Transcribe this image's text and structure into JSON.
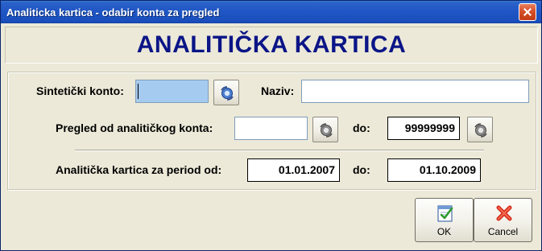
{
  "window": {
    "title": "Analiticka kartica - odabir konta za pregled"
  },
  "banner": {
    "title": "ANALITIČKA KARTICA"
  },
  "form": {
    "sinteticki_label": "Sintetički konto:",
    "sinteticki_value": "",
    "naziv_label": "Naziv:",
    "naziv_value": "",
    "pregled_label": "Pregled od analitičkog konta:",
    "pregled_od_value": "",
    "do_label": "do:",
    "pregled_do_value": "99999999",
    "period_label": "Analitička kartica za period od:",
    "period_od_value": "01.01.2007",
    "period_do_label": "do:",
    "period_do_value": "01.10.2009"
  },
  "buttons": {
    "ok_label": "OK",
    "cancel_label": "Cancel"
  },
  "colors": {
    "banner_text": "#0b1587",
    "active_field": "#a6cbf0",
    "titlebar": "#1f55c4"
  },
  "icons": {
    "lookup": "refresh-lookup-icon",
    "ok": "checkmark-document-icon",
    "cancel": "red-x-icon"
  }
}
